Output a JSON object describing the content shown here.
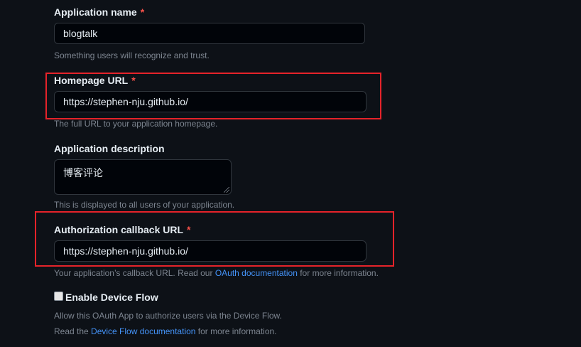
{
  "fields": {
    "app_name": {
      "label": "Application name",
      "required_mark": "*",
      "value": "blogtalk",
      "hint": "Something users will recognize and trust."
    },
    "homepage_url": {
      "label": "Homepage URL",
      "required_mark": "*",
      "value": "https://stephen-nju.github.io/",
      "hint": "The full URL to your application homepage."
    },
    "description": {
      "label": "Application description",
      "value": "博客评论",
      "hint": "This is displayed to all users of your application."
    },
    "callback_url": {
      "label": "Authorization callback URL",
      "required_mark": "*",
      "value": "https://stephen-nju.github.io/",
      "hint_prefix": "Your application’s callback URL. Read our ",
      "hint_link": "OAuth documentation",
      "hint_suffix": " for more information."
    }
  },
  "device_flow": {
    "label": "Enable Device Flow",
    "checked": false,
    "hint": "Allow this OAuth App to authorize users via the Device Flow.",
    "hint2_prefix": "Read the ",
    "hint2_link": "Device Flow documentation",
    "hint2_suffix": " for more information."
  },
  "colors": {
    "background": "#0d1117",
    "highlight_box": "#e5232a",
    "link": "#4493f8",
    "required": "#f85149"
  }
}
